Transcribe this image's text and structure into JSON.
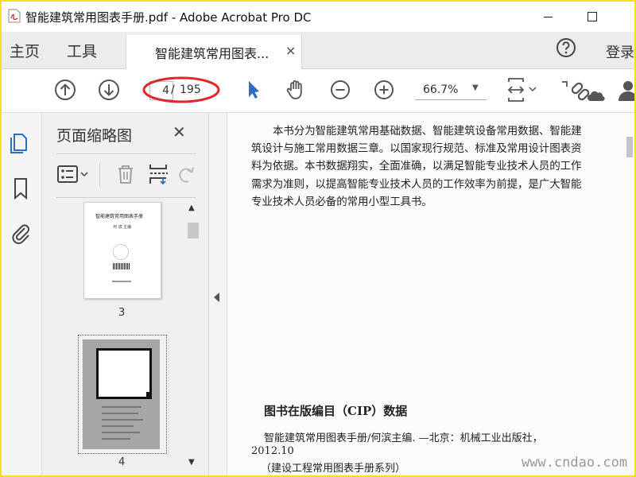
{
  "window": {
    "title": "智能建筑常用图表手册.pdf - Adobe Acrobat Pro DC"
  },
  "menubar": {
    "home": "主页",
    "tools": "工具",
    "tab_label": "智能建筑常用图表...",
    "tab_close": "×",
    "login": "登录"
  },
  "toolbar": {
    "current_page": "4",
    "page_separator": "/",
    "total_pages": "195",
    "zoom": "66.7%",
    "zoom_caret": "▼"
  },
  "thumbnails": {
    "panel_title": "页面缩略图",
    "close": "✕",
    "page3_title": "智能建筑常用图表手册",
    "page3_author": "何 滨 主编",
    "page3_label": "3",
    "page4_label": "4"
  },
  "document": {
    "paragraph": "本书分为智能建筑常用基础数据、智能建筑设备常用数据、智能建筑设计与施工常用数据三章。以国家现行规范、标准及常用设计图表资料为依据。本书数据翔实，全面准确，以满足智能专业技术人员的工作需求为准则，以提高智能专业技术人员的工作效率为前提，是广大智能专业技术人员必备的常用小型工具书。",
    "cip_title": "图书在版编目（CIP）数据",
    "cip_line1": "智能建筑常用图表手册/何滨主编. —北京：机械工业出版社，",
    "cip_line2": "2012.10",
    "cip_line3": "（建设工程常用图表手册系列）",
    "watermark": "www.cndao.com"
  },
  "icons": {
    "app": "acrobat-pdf-icon",
    "help": "help-icon",
    "prev_page": "arrow-up-circle-icon",
    "next_page": "arrow-down-circle-icon",
    "select": "pointer-icon",
    "hand": "hand-icon",
    "zoom_out": "zoom-out-icon",
    "zoom_in": "zoom-in-icon",
    "fit": "fit-page-icon",
    "share": "share-link-icon",
    "user": "user-icon",
    "rail_thumbnails": "page-thumbnails-icon",
    "rail_bookmarks": "bookmark-icon",
    "rail_attachments": "paperclip-icon",
    "options": "options-menu-icon",
    "delete": "trash-icon",
    "insert": "insert-pages-icon",
    "rotate": "rotate-icon"
  },
  "colors": {
    "accent_blue": "#2c6fbf",
    "annotation_oval": "#e0262a",
    "frame_border": "#f2e21a"
  }
}
